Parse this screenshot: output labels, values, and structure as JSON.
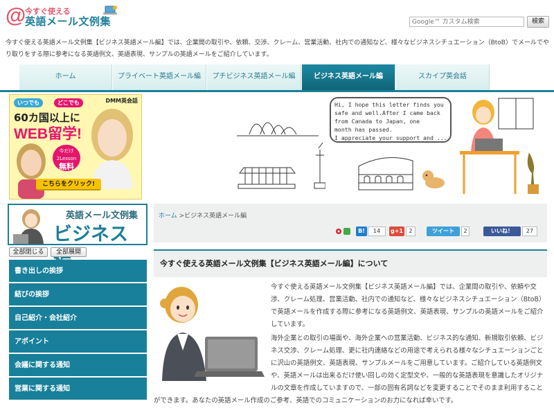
{
  "header": {
    "logo_at": "@",
    "logo_line1": "今すぐ使える",
    "logo_line2": "英語メール文例集",
    "search_placeholder": "Google™ カスタム検索",
    "search_button": "検索"
  },
  "intro": "今すぐ使える英語メール文例集【ビジネス英語メール編】では、企業間の取引や、依頼、交渉、クレーム、営業活動、社内での通知など、様々なビジネスシチュエーション（BtoB）でメールでやり取りをする際に参考になる英語例文、英語表現、サンプルの英語メールをご紹介しています。",
  "nav": {
    "tabs": [
      {
        "label": "ホーム"
      },
      {
        "label": "プライベート英語メール編"
      },
      {
        "label": "プチビジネス英語メール編"
      },
      {
        "label": "ビジネス英語メール編"
      },
      {
        "label": "スカイプ英会話"
      }
    ]
  },
  "ad": {
    "brand": "DMM英会話",
    "pill1": "いつでも",
    "pill2": "どこでも",
    "line1": "60カ国以上に",
    "line2": "WEB留学!",
    "lesson_top": "今だけ",
    "lesson_mid": "2Lesson",
    "lesson_bottom": "無料",
    "cta": "こちらをクリック!"
  },
  "hero": {
    "bubble_text": "Hi, I hope this letter finds you\nsafe and well.After I came back\nfrom Canada to Japan, one\nmonth has passed.\nI appreciate your support and ..."
  },
  "sidebar": {
    "banner_line1": "英語メール文例集",
    "banner_line2": "ビジネス編",
    "collapse_all": "全部閉じる",
    "expand_all": "全部展開",
    "menu": [
      {
        "label": "書き出しの挨拶"
      },
      {
        "label": "結びの挨拶"
      },
      {
        "label": "自己紹介・会社紹介"
      },
      {
        "label": "アポイント"
      },
      {
        "label": "会議に関する通知"
      },
      {
        "label": "営業に関する通知"
      }
    ]
  },
  "breadcrumb": {
    "home": "ホーム",
    "sep": " >",
    "current": "ビジネス英語メール編"
  },
  "social": {
    "hatena": "B!",
    "hatena_count": "14",
    "gplus": "g+1",
    "gplus_count": "2",
    "tweet": "ツイート",
    "tweet_count": "2",
    "like": "いいね！",
    "like_count": "27"
  },
  "article": {
    "title": "今すぐ使える英語メール文例集【ビジネス英語メール編】について",
    "p1": "今すぐ使える英語メール文例集【ビジネス英語メール編】では、企業間の取引や、依頼や交渉、クレーム処理、営業活動、社内での通知など、様々なビジネスシチュエーション（BtoB）で英語メールを作成する際に参考になる英語例文、英語表現、サンプルの英語メールをご紹介しています。",
    "p2": "海外企業との取引の場面や、海外企業への営業活動、ビジネス的な通知、新規取引依頼、ビジネス交渉、クレーム処理、更に社内連絡などの用途で考えられる様々なシチュエーションごとに沢山の英語例文、英語表現、サンプルメールをご用意しています。ご紹介している英語例文や、英語メールは出来るだけ使い回しの効く定型文や、一般的な英語表現を意識したオリジナルの文章を作成していますので、一部の固有名詞などを変更することでそのまま利用することができます。あなたの英語メール作成のご参考、英語でのコミュニケーションのお力になれば幸いです。"
  },
  "colors": {
    "accent": "#1b7f98",
    "logo_pink": "#e2566b",
    "ad_bg": "#fff7b2"
  }
}
